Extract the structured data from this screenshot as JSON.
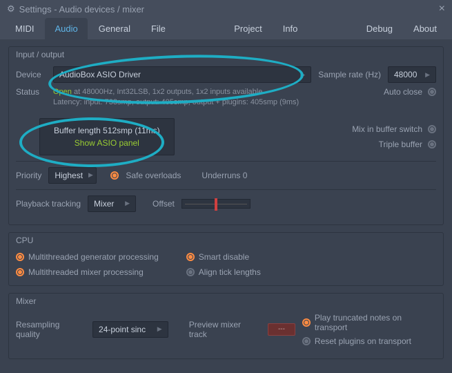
{
  "window": {
    "title": "Settings - Audio devices / mixer"
  },
  "tabs": [
    "MIDI",
    "Audio",
    "General",
    "File",
    "Project",
    "Info",
    "Debug",
    "About"
  ],
  "active_tab": "Audio",
  "io": {
    "title": "Input / output",
    "device_label": "Device",
    "device_value": "AudioBox ASIO Driver",
    "sample_rate_label": "Sample rate (Hz)",
    "sample_rate_value": "48000",
    "status_label": "Status",
    "status_line1_open": "Open",
    "status_line1_rest": " at 48000Hz, Int32LSB, 1x2 outputs, 1x2 inputs available",
    "status_line2": "Latency: input: 733smp, output: 405smp, output + plugins: 405smp (9ms)",
    "auto_close": "Auto close",
    "buffer_length": "Buffer length 512smp (11ms)",
    "show_asio": "Show ASIO panel",
    "mix_in_buffer": "Mix in buffer switch",
    "triple_buffer": "Triple buffer",
    "priority_label": "Priority",
    "priority_value": "Highest",
    "safe_overloads": "Safe overloads",
    "underruns": "Underruns 0",
    "playback_tracking_label": "Playback tracking",
    "playback_tracking_value": "Mixer",
    "offset_label": "Offset"
  },
  "cpu": {
    "title": "CPU",
    "mt_gen": "Multithreaded generator processing",
    "mt_mix": "Multithreaded mixer processing",
    "smart_disable": "Smart disable",
    "align_tick": "Align tick lengths"
  },
  "mixer": {
    "title": "Mixer",
    "resampling_label": "Resampling quality",
    "resampling_value": "24-point sinc",
    "preview_label": "Preview mixer track",
    "preview_value": "---",
    "play_truncated": "Play truncated notes on transport",
    "reset_plugins": "Reset plugins on transport"
  }
}
